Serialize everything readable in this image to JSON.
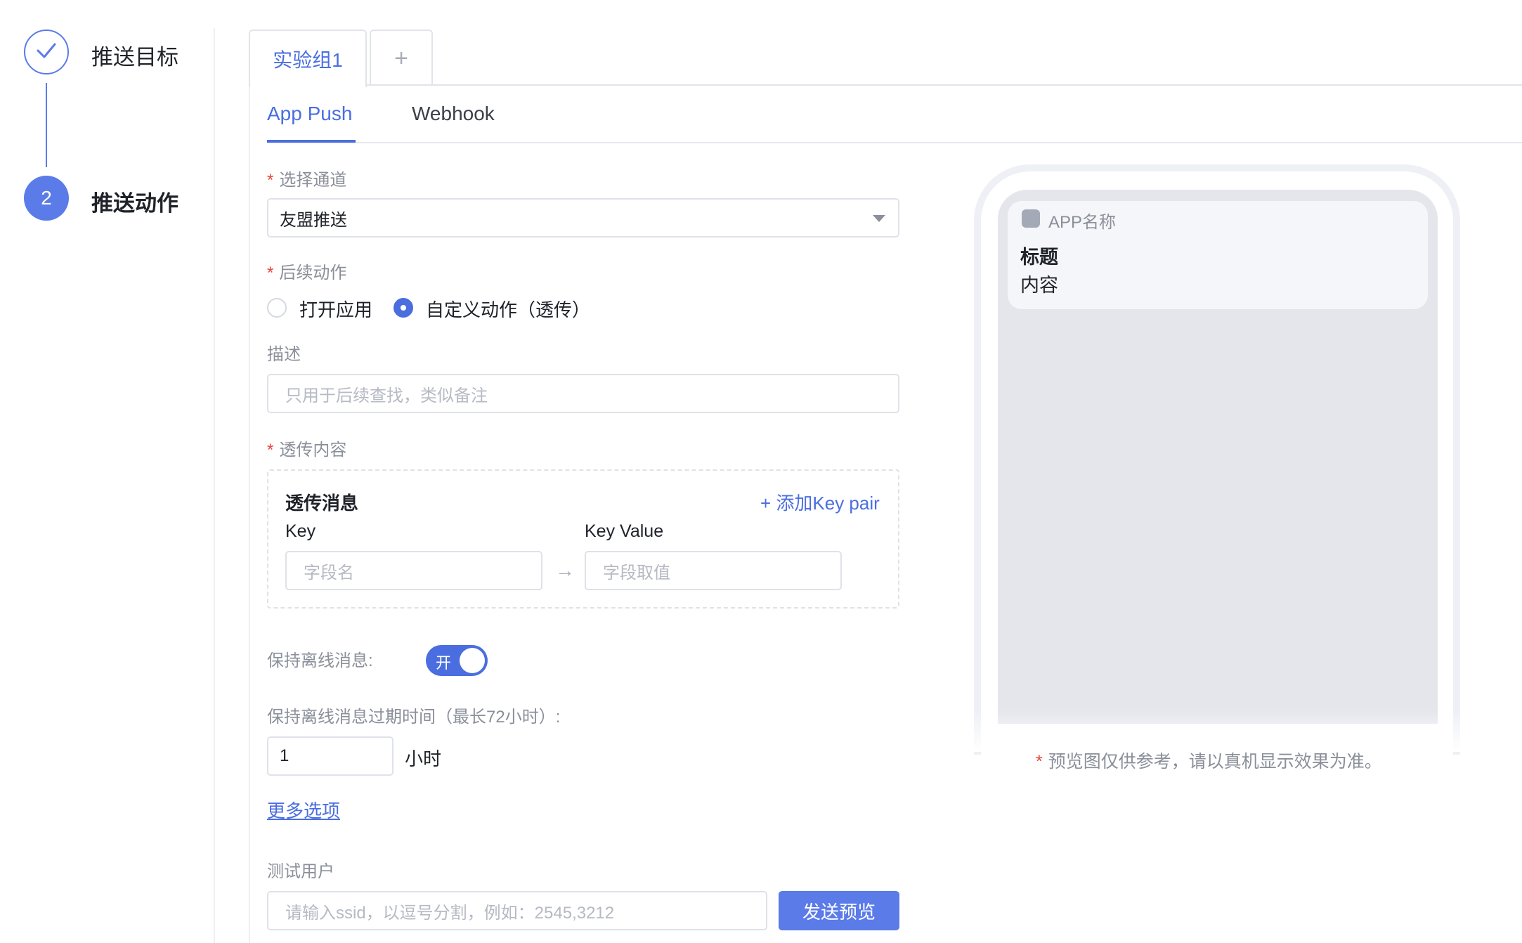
{
  "steps": [
    {
      "label": "推送目标",
      "status": "done"
    },
    {
      "label": "推送动作",
      "number": "2",
      "status": "active"
    }
  ],
  "top_tabs": {
    "active": "实验组1",
    "add": "+"
  },
  "sub_tabs": {
    "active": "App Push",
    "inactive": "Webhook"
  },
  "form": {
    "required_mark": "*",
    "channel": {
      "label": "选择通道",
      "value": "友盟推送"
    },
    "follow_action": {
      "label": "后续动作",
      "options": [
        {
          "label": "打开应用",
          "selected": false
        },
        {
          "label": "自定义动作（透传）",
          "selected": true
        }
      ]
    },
    "description": {
      "label": "描述",
      "placeholder": "只用于后续查找，类似备注"
    },
    "passthrough": {
      "label": "透传内容",
      "title": "透传消息",
      "add_label": "+ 添加Key pair",
      "key_label": "Key",
      "value_label": "Key Value",
      "key_placeholder": "字段名",
      "value_placeholder": "字段取值",
      "arrow": "→"
    },
    "offline": {
      "label": "保持离线消息:",
      "toggle_text": "开",
      "on": true
    },
    "expire": {
      "label": "保持离线消息过期时间（最长72小时）:",
      "value": "1",
      "unit": "小时"
    },
    "more_options": "更多选项",
    "test_user": {
      "label": "测试用户",
      "placeholder": "请输入ssid，以逗号分割，例如：2545,3212",
      "button": "发送预览"
    }
  },
  "preview": {
    "app_name": "APP名称",
    "title": "标题",
    "content": "内容",
    "note_mark": "*",
    "note": "预览图仅供参考，请以真机显示效果为准。"
  },
  "colors": {
    "accent": "#4a6ee0",
    "required": "#e8453c",
    "muted": "#8a8f99"
  },
  "icons": {
    "step_done": "check-icon",
    "select_caret": "caret-down-icon",
    "app": "app-icon"
  }
}
